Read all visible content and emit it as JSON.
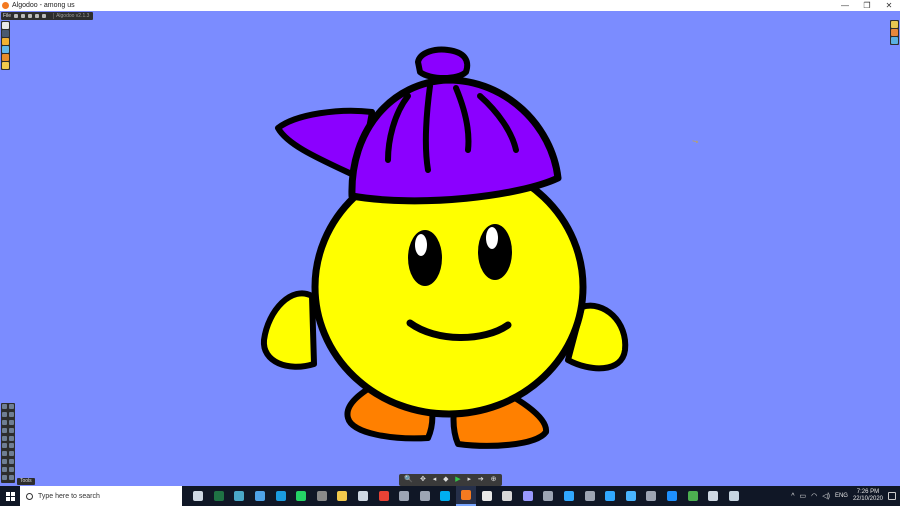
{
  "window": {
    "title": "Algodoo - among us",
    "minimize": "—",
    "maximize": "❐",
    "close": "✕"
  },
  "file_toolbar": {
    "label": "File",
    "version": "Algodoo v2.1.3"
  },
  "tools_panel": {
    "label": "Tools"
  },
  "sim_toolbar": {
    "zoom_icon": "🔍",
    "move_icon": "✥",
    "prev": "◂",
    "dot": "◆",
    "play": "▶",
    "next": "▸",
    "arrow": "➔",
    "gravity": "⊕"
  },
  "taskbar": {
    "search_placeholder": "Type here to search",
    "tray": {
      "chevron": "^",
      "language": "ENG",
      "time": "7:26 PM",
      "date": "22/10/2020"
    }
  },
  "character": {
    "name": "",
    "colors": {
      "body": "#ffff00",
      "cap": "#8b00ff",
      "feet": "#ff8000",
      "outline": "#000000",
      "background": "#7b8cff"
    }
  },
  "taskbar_icons": [
    {
      "name": "task-view-icon",
      "color": "#cfd8e3"
    },
    {
      "name": "excel-icon",
      "color": "#1f7244"
    },
    {
      "name": "app-diamond-icon",
      "color": "#4aa8c8"
    },
    {
      "name": "photos-icon",
      "color": "#4fa3e8"
    },
    {
      "name": "edge-icon",
      "color": "#1b9ce0"
    },
    {
      "name": "whatsapp-icon",
      "color": "#25d366"
    },
    {
      "name": "app-grey-icon",
      "color": "#8a8a8a"
    },
    {
      "name": "folder-icon",
      "color": "#f2c94c"
    },
    {
      "name": "stack-icon",
      "color": "#cfd8e3"
    },
    {
      "name": "chrome-icon",
      "color": "#e94235"
    },
    {
      "name": "app-circle-icon",
      "color": "#9da5b4"
    },
    {
      "name": "gamepad-icon",
      "color": "#9da5b4"
    },
    {
      "name": "skype-icon",
      "color": "#00aff0"
    },
    {
      "name": "algodoo-icon",
      "color": "#f47a20"
    },
    {
      "name": "paint-icon",
      "color": "#e8e8e8"
    },
    {
      "name": "unity-icon",
      "color": "#d8d8d8"
    },
    {
      "name": "premiere-icon",
      "color": "#9999ff"
    },
    {
      "name": "files-icon",
      "color": "#9da5b4"
    },
    {
      "name": "lightroom-icon",
      "color": "#31a8ff"
    },
    {
      "name": "app-bar-icon",
      "color": "#9da5b4"
    },
    {
      "name": "photoshop-icon",
      "color": "#31a8ff"
    },
    {
      "name": "wifi-app-icon",
      "color": "#49b4ff"
    },
    {
      "name": "app-tri-icon",
      "color": "#9da5b4"
    },
    {
      "name": "app-blue-icon",
      "color": "#1e90ff"
    },
    {
      "name": "gamebar-icon",
      "color": "#4caf50"
    },
    {
      "name": "app-rect-icon",
      "color": "#cfd8e3"
    },
    {
      "name": "steam-icon",
      "color": "#c7d5e0"
    }
  ]
}
